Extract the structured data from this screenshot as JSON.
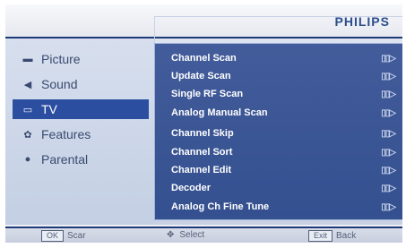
{
  "brand": "PHILIPS",
  "sidebar": {
    "items": [
      {
        "label": "Picture",
        "icon": "picture-icon",
        "glyph": "▬"
      },
      {
        "label": "Sound",
        "icon": "speaker-icon",
        "glyph": "◀"
      },
      {
        "label": "TV",
        "icon": "tv-icon",
        "glyph": "▭",
        "selected": true
      },
      {
        "label": "Features",
        "icon": "gear-icon",
        "glyph": "✿"
      },
      {
        "label": "Parental",
        "icon": "lock-icon",
        "glyph": "●"
      }
    ]
  },
  "submenu": {
    "items": [
      {
        "label": "Channel Scan",
        "arrow": "▯▯▷"
      },
      {
        "label": "Update Scan",
        "arrow": "▯▯▷"
      },
      {
        "label": "Single RF Scan",
        "arrow": "▯▯▷"
      },
      {
        "label": "Analog Manual Scan",
        "arrow": "▯▯▷"
      },
      {
        "label": "Channel Skip",
        "arrow": "▯▯▷"
      },
      {
        "label": "Channel Sort",
        "arrow": "▯▯▷"
      },
      {
        "label": "Channel Edit",
        "arrow": "▯▯▷"
      },
      {
        "label": "Decoder",
        "arrow": "▯▯▷"
      },
      {
        "label": "Analog Ch Fine Tune",
        "arrow": "▯▯▷"
      }
    ]
  },
  "footer": {
    "ok_key": "OK",
    "ok_label": "Scar",
    "select_label": "Select",
    "exit_key": "Exit",
    "exit_label": "Back"
  }
}
